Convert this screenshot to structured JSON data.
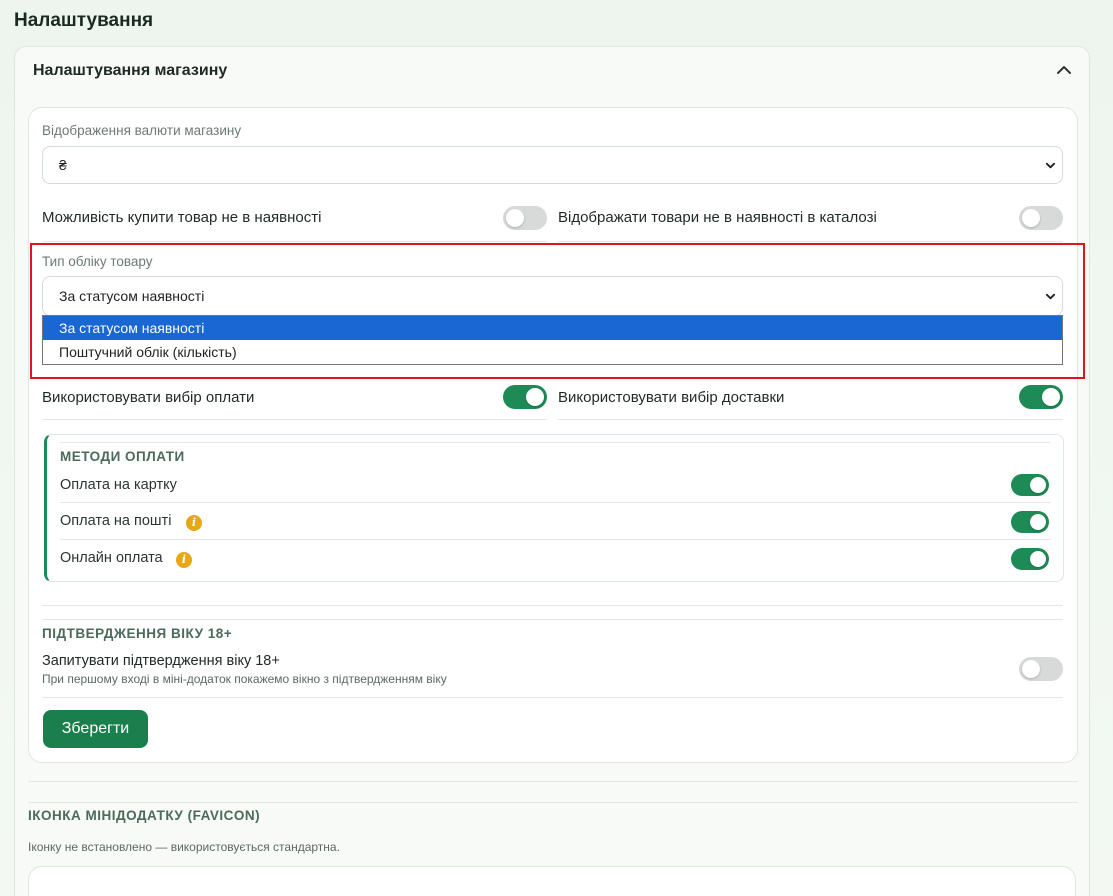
{
  "page_title": "Налаштування",
  "store_settings": {
    "title": "Налаштування магазину",
    "currency": {
      "label": "Відображення валюти магазину",
      "value": "₴"
    },
    "buy_out_of_stock": {
      "label": "Можливість купити товар не в наявності",
      "on": false
    },
    "show_out_of_stock": {
      "label": "Відображати товари не в наявності в каталозі",
      "on": false
    },
    "accounting": {
      "label": "Тип обліку товару",
      "value": "За статусом наявності",
      "options": [
        "За статусом наявності",
        "Поштучний облік (кількість)"
      ]
    },
    "use_payment": {
      "label": "Використовувати вибір оплати",
      "on": true
    },
    "use_delivery": {
      "label": "Використовувати вибір доставки",
      "on": true
    },
    "payment_methods": {
      "title": "МЕТОДИ ОПЛАТИ",
      "items": [
        {
          "label": "Оплата на картку",
          "on": true,
          "info": false
        },
        {
          "label": "Оплата на пошті",
          "on": true,
          "info": true
        },
        {
          "label": "Онлайн оплата",
          "on": true,
          "info": true
        }
      ]
    },
    "age": {
      "title": "ПІДТВЕРДЖЕННЯ ВІКУ 18+",
      "label": "Запитувати підтвердження віку 18+",
      "hint": "При першому вході в міні-додаток покажемо вікно з підтвердженням віку",
      "on": false
    },
    "save_label": "Зберегти"
  },
  "favicon": {
    "title": "ІКОНКА МІНІДОДАТКУ (FAVICON)",
    "hint": "Іконку не встановлено — використовується стандартна."
  },
  "colors": {
    "accent": "#1e8a55",
    "highlight": "#e0141b",
    "selection": "#1a66d2"
  }
}
